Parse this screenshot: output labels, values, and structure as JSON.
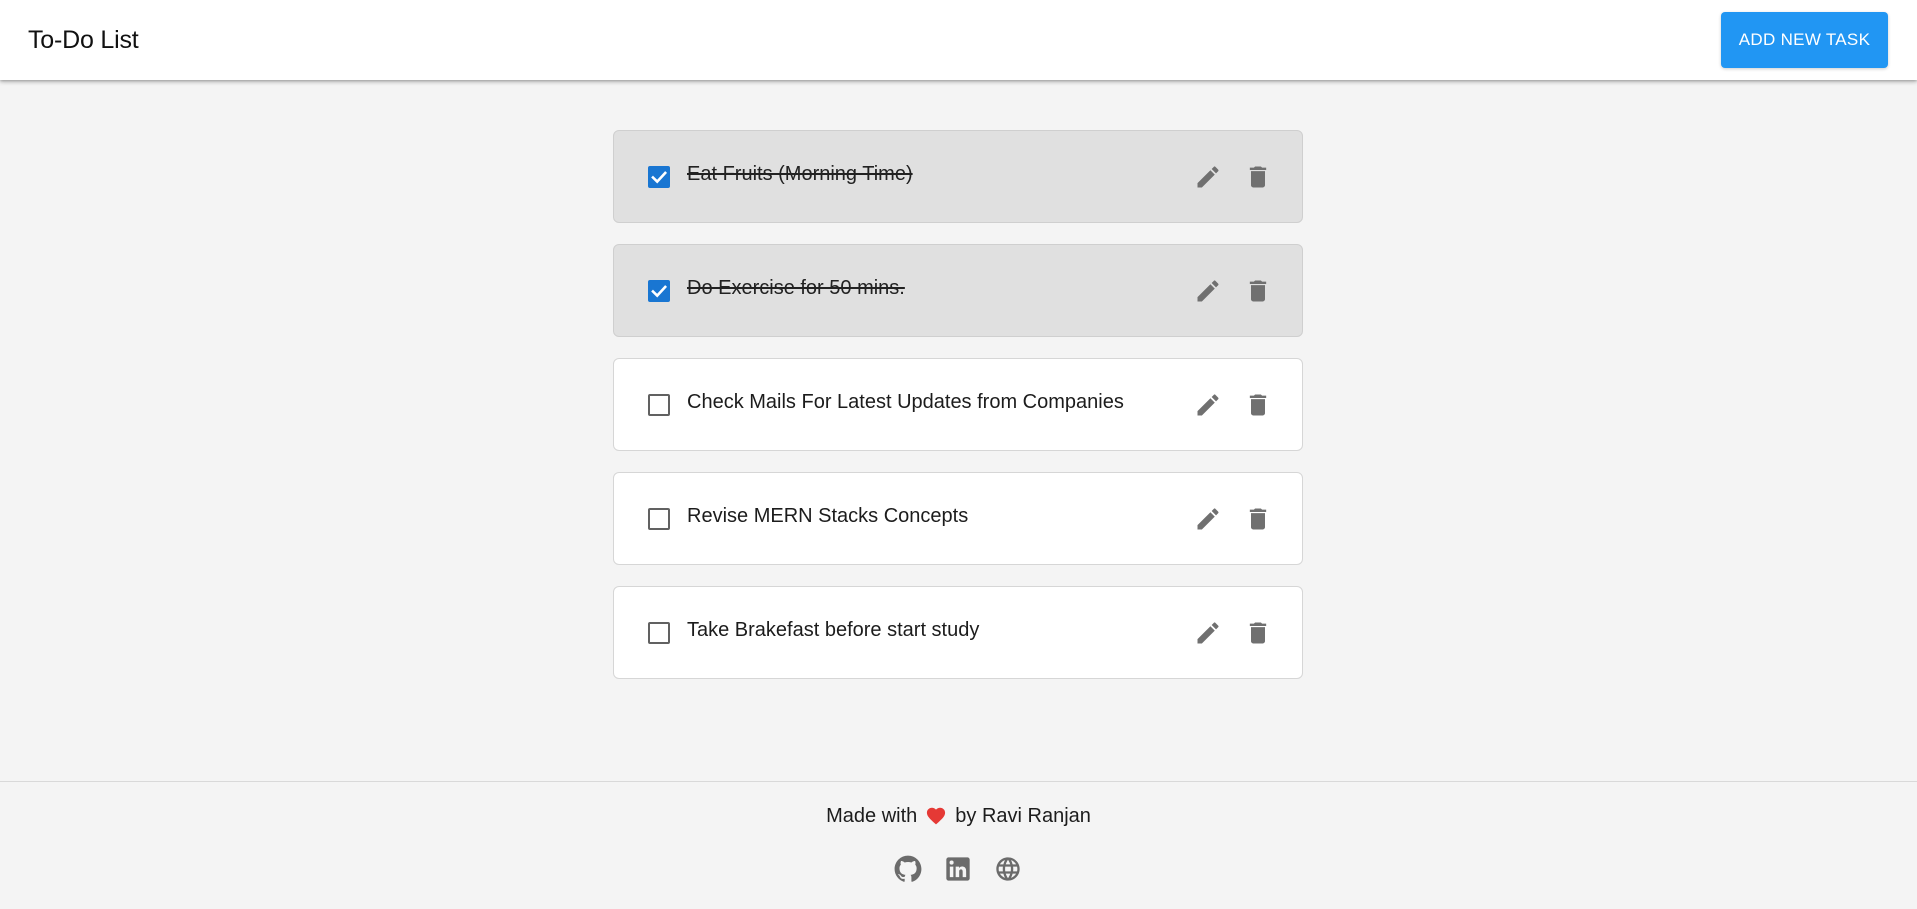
{
  "header": {
    "title": "To-Do List",
    "add_button_label": "ADD NEW TASK"
  },
  "tasks": [
    {
      "label": "Eat Fruits (Morning Time)",
      "completed": true
    },
    {
      "label": "Do Exercise for 50 mins.",
      "completed": true
    },
    {
      "label": "Check Mails For Latest Updates from Companies",
      "completed": false
    },
    {
      "label": "Revise MERN Stacks Concepts",
      "completed": false
    },
    {
      "label": "Take Brakefast before start study",
      "completed": false
    }
  ],
  "task_icons": {
    "edit": "pencil-icon",
    "delete": "trash-icon"
  },
  "footer": {
    "made_with": "Made with",
    "by_text": "by Ravi Ranjan",
    "heart_icon": "heart-icon",
    "social_icons": [
      "github-icon",
      "linkedin-icon",
      "globe-icon"
    ]
  },
  "colors": {
    "accent": "#2196f3",
    "checkbox_checked": "#1976d2",
    "heart": "#e53935",
    "icon_gray": "#707070",
    "completed_background": "#e0e0e0"
  }
}
